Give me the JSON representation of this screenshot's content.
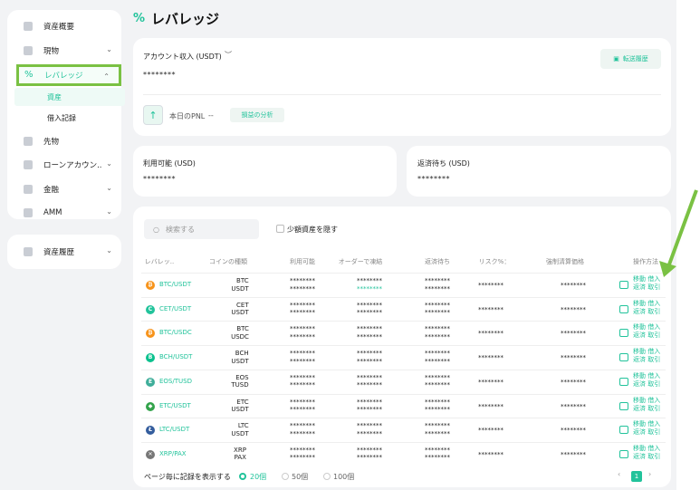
{
  "sidebar": {
    "items": [
      {
        "label": "資産概要",
        "icon": "wallet-icon"
      },
      {
        "label": "現物",
        "icon": "coin-icon"
      },
      {
        "label": "レバレッジ",
        "icon": "percent-icon"
      },
      {
        "label": "先物",
        "icon": "futures-icon"
      },
      {
        "label": "ローンアカウン..",
        "icon": "loan-icon"
      },
      {
        "label": "金融",
        "icon": "finance-icon"
      },
      {
        "label": "AMM",
        "icon": "amm-icon"
      }
    ],
    "sub_items": [
      "資産",
      "借入記録"
    ],
    "history": "資産履歴"
  },
  "page": {
    "title": "レバレッジ"
  },
  "account": {
    "label": "アカウント収入 (USDT)",
    "value": "********",
    "history_button": "転送履歴",
    "pnl_label": "本日のPNL",
    "pnl_value": "--",
    "analysis_button": "損益の分析"
  },
  "available": {
    "label": "利用可能 (USD)",
    "value": "********"
  },
  "repay_pending": {
    "label": "返済待ち (USD)",
    "value": "********"
  },
  "table": {
    "search_placeholder": "検索する",
    "hide_small": "少額資産を隠す",
    "headers": [
      "レバレッ..",
      "コインの種類",
      "利用可能",
      "オーダーで凍結",
      "返済待ち",
      "リスク%：",
      "強制清算価格",
      "操作方法"
    ],
    "mask": "********",
    "ops": {
      "move": "移動",
      "borrow": "借入",
      "repay": "返済",
      "trade": "取引"
    },
    "rows": [
      {
        "pair": "BTC/USDT",
        "base": "BTC",
        "quote": "USDT",
        "icon_color": "#f7931a",
        "icon_char": "₿"
      },
      {
        "pair": "CET/USDT",
        "base": "CET",
        "quote": "USDT",
        "icon_color": "#22c39b",
        "icon_char": "C"
      },
      {
        "pair": "BTC/USDC",
        "base": "BTC",
        "quote": "USDC",
        "icon_color": "#f7931a",
        "icon_char": "₿"
      },
      {
        "pair": "BCH/USDT",
        "base": "BCH",
        "quote": "USDT",
        "icon_color": "#0ac18e",
        "icon_char": "B"
      },
      {
        "pair": "EOS/TUSD",
        "base": "EOS",
        "quote": "TUSD",
        "icon_color": "#3fae9a",
        "icon_char": "E"
      },
      {
        "pair": "ETC/USDT",
        "base": "ETC",
        "quote": "USDT",
        "icon_color": "#33a34b",
        "icon_char": "◆"
      },
      {
        "pair": "LTC/USDT",
        "base": "LTC",
        "quote": "USDT",
        "icon_color": "#345d9d",
        "icon_char": "Ł"
      },
      {
        "pair": "XRP/PAX",
        "base": "XRP",
        "quote": "PAX",
        "icon_color": "#777777",
        "icon_char": "✕"
      }
    ]
  },
  "footer": {
    "per_page_label": "ページ毎に記録を表示する",
    "options": [
      "20個",
      "50個",
      "100個"
    ],
    "page": "1"
  },
  "colors": {
    "accent": "#22c39b",
    "highlight": "#7ac143"
  }
}
